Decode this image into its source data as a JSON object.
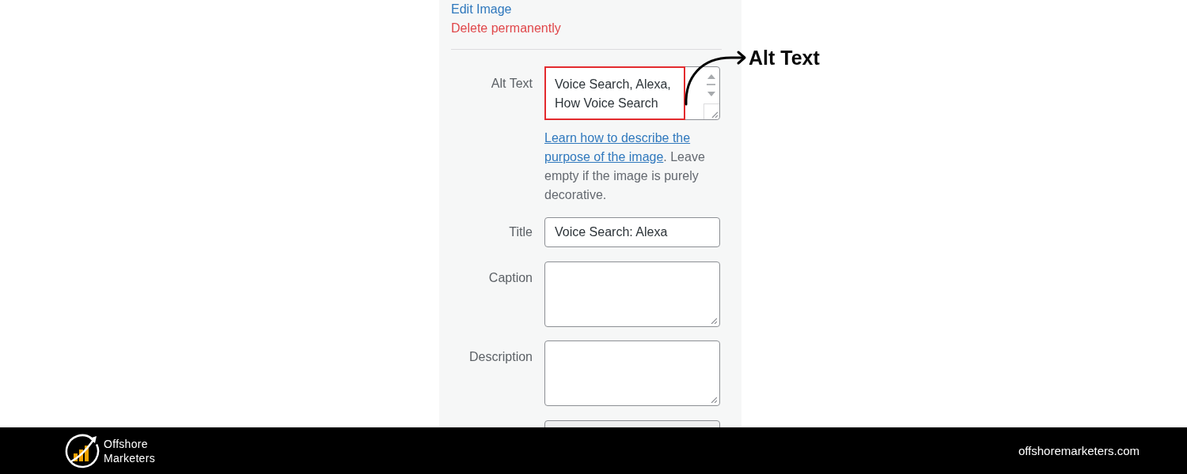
{
  "panel": {
    "links": [
      {
        "label": "Edit Image",
        "kind": "edit"
      },
      {
        "label": "Delete permanently",
        "kind": "delete"
      }
    ],
    "fields": [
      {
        "label": "Alt Text",
        "kind": "scroll-textarea",
        "value": "Voice Search, Alexa, How Voice Search",
        "help": {
          "link": [
            "Learn how to describe the",
            "purpose of the image"
          ],
          "text": ". Leave empty if the image is purely decorative."
        }
      },
      {
        "label": "Title",
        "kind": "input",
        "value": "Voice Search: Alexa"
      },
      {
        "label": "Caption",
        "kind": "textarea"
      },
      {
        "label": "Description",
        "kind": "textarea"
      }
    ],
    "cut_off_field": {
      "readonly": true
    }
  },
  "annotation": {
    "label": "Alt Text"
  },
  "footer": {
    "brand": "Offshore Marketers",
    "url": "offshoremarketers.com"
  }
}
